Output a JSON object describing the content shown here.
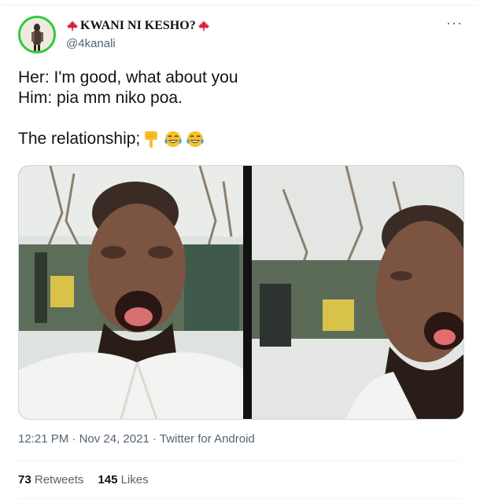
{
  "user": {
    "display_name": "KWANI NI KESHO?",
    "handle": "@4kanali",
    "name_icons": [
      "maple-leaf-icon",
      "maple-leaf-icon"
    ],
    "verified_ring_color": "#2ecc3a"
  },
  "menu": {
    "more_label": "···"
  },
  "tweet": {
    "line1": "Her: I'm good, what about you",
    "line2": "Him: pia mm niko poa.",
    "line3": "The relationship;",
    "emojis": [
      "pointing-down-icon",
      "tears-of-joy-icon",
      "tears-of-joy-icon"
    ]
  },
  "media": {
    "panels": [
      "left-face-frame",
      "right-face-frame"
    ]
  },
  "meta": {
    "time": "12:21 PM",
    "date": "Nov 24, 2021",
    "sep": "·",
    "source": "Twitter for Android"
  },
  "stats": {
    "retweets_count": "73",
    "retweets_label": "Retweets",
    "likes_count": "145",
    "likes_label": "Likes"
  },
  "colors": {
    "text": "#0f1419",
    "secondary": "#536471",
    "maple": "#d6203a"
  }
}
